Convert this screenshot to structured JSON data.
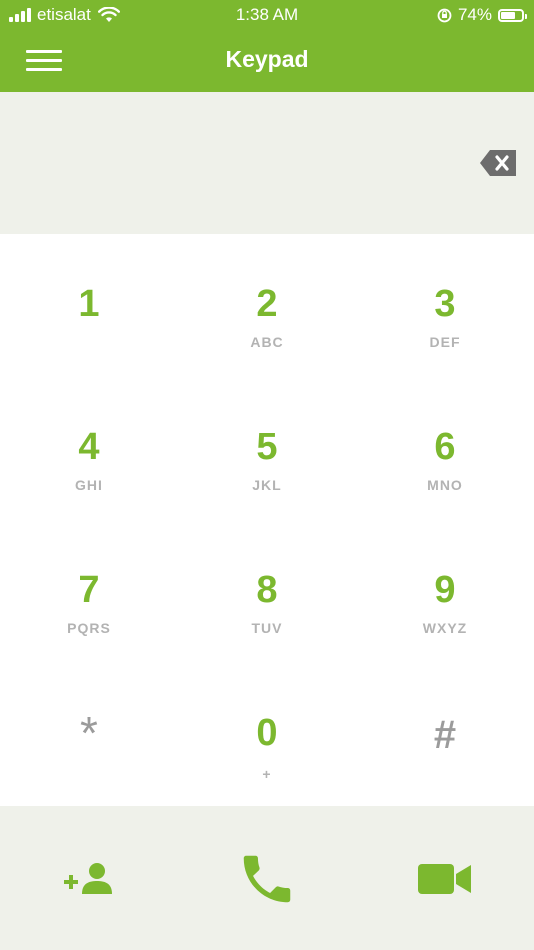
{
  "status_bar": {
    "carrier": "etisalat",
    "time": "1:38 AM",
    "battery_percent": "74%",
    "battery_level": 0.74
  },
  "nav": {
    "title": "Keypad"
  },
  "display": {
    "number": ""
  },
  "keys": [
    {
      "digit": "1",
      "letters": ""
    },
    {
      "digit": "2",
      "letters": "ABC"
    },
    {
      "digit": "3",
      "letters": "DEF"
    },
    {
      "digit": "4",
      "letters": "GHI"
    },
    {
      "digit": "5",
      "letters": "JKL"
    },
    {
      "digit": "6",
      "letters": "MNO"
    },
    {
      "digit": "7",
      "letters": "PQRS"
    },
    {
      "digit": "8",
      "letters": "TUV"
    },
    {
      "digit": "9",
      "letters": "WXYZ"
    },
    {
      "digit": "*",
      "letters": ""
    },
    {
      "digit": "0",
      "letters": "+"
    },
    {
      "digit": "#",
      "letters": ""
    }
  ],
  "colors": {
    "brand_green": "#7cb82f",
    "panel_background": "#eff1ea",
    "letters_gray": "#b3b3b3",
    "icon_gray": "#6d6d6d"
  },
  "icons": {
    "menu": "hamburger-menu-icon",
    "backspace": "backspace-icon",
    "add_contact": "add-contact-icon",
    "call": "phone-icon",
    "video": "video-camera-icon"
  }
}
